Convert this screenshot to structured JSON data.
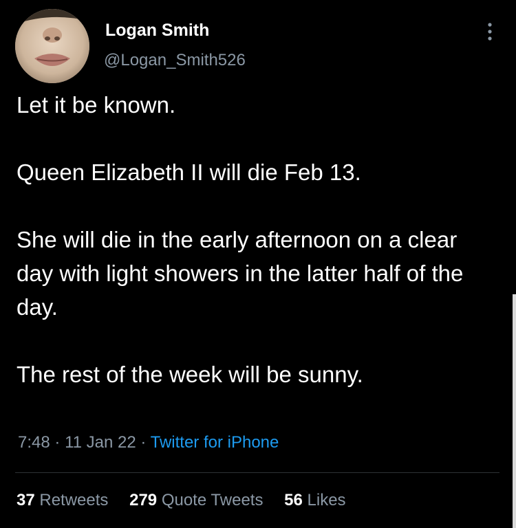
{
  "author": {
    "display_name": "Logan Smith",
    "handle": "@Logan_Smith526",
    "avatar_icon": "profile-photo"
  },
  "menu": {
    "icon": "more-vertical-icon"
  },
  "tweet": {
    "paragraphs": [
      "Let it be known.",
      "Queen Elizabeth II will die Feb 13.",
      "She will die in the early afternoon on a clear day with light showers in the latter half of the day.",
      "The rest of the week will be sunny."
    ],
    "time": "7:48",
    "date": "11 Jan 22",
    "separator": "·",
    "source": "Twitter for iPhone"
  },
  "stats": {
    "retweets": {
      "count": "37",
      "label": "Retweets"
    },
    "quote_tweets": {
      "count": "279",
      "label": "Quote Tweets"
    },
    "likes": {
      "count": "56",
      "label": "Likes"
    }
  },
  "colors": {
    "background": "#000000",
    "primary_text": "#ffffff",
    "secondary_text": "#8b98a5",
    "link": "#1d9bf0",
    "divider": "#2f3336"
  }
}
